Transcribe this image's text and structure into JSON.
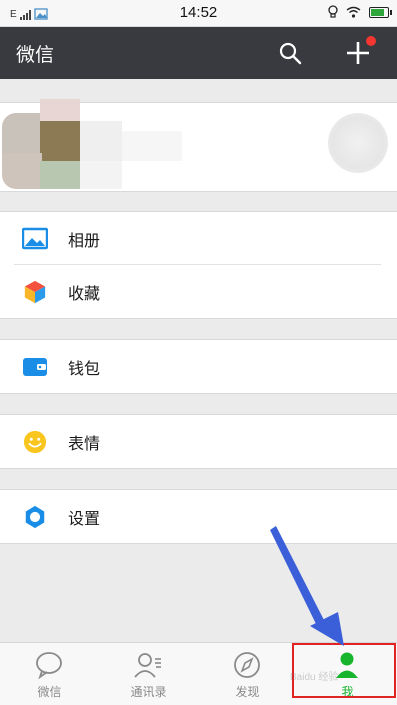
{
  "statusbar": {
    "network": "E",
    "time": "14:52"
  },
  "appbar": {
    "title": "微信"
  },
  "menu": {
    "groups": [
      [
        {
          "label": "相册",
          "icon": "album-icon"
        },
        {
          "label": "收藏",
          "icon": "favorites-icon"
        }
      ],
      [
        {
          "label": "钱包",
          "icon": "wallet-icon"
        }
      ],
      [
        {
          "label": "表情",
          "icon": "sticker-icon"
        }
      ],
      [
        {
          "label": "设置",
          "icon": "settings-icon"
        }
      ]
    ]
  },
  "tabbar": {
    "tabs": [
      {
        "label": "微信",
        "icon": "chat-bubble-icon",
        "active": false
      },
      {
        "label": "通讯录",
        "icon": "contacts-icon",
        "active": false
      },
      {
        "label": "发现",
        "icon": "compass-icon",
        "active": false
      },
      {
        "label": "我",
        "icon": "person-icon",
        "active": true
      }
    ]
  },
  "colors": {
    "appbar": "#393a3f",
    "active_tab": "#16b52d",
    "notification_dot": "#f43530",
    "highlight": "#e02323",
    "arrow": "#3b5fd9"
  },
  "watermark": "Baidu 经验"
}
